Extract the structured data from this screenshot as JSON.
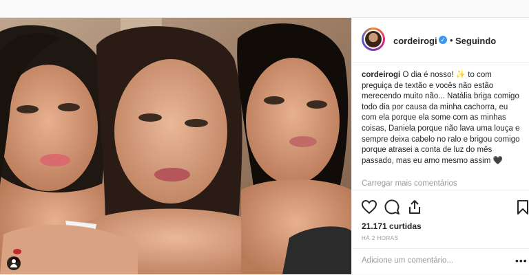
{
  "post": {
    "username": "cordeirogi",
    "verified_icon": "verified-badge-icon",
    "separator": "•",
    "follow_status": "Seguindo",
    "caption_username": "cordeirogi",
    "caption_text": "O dia é nosso! ✨ to com preguiça de textão e vocês não estão merecendo muito não... Natália briga comigo todo dia por causa da minha cachorra, eu com ela porque ela some com as minhas coisas, Daniela porque não lava uma louça e sempre deixa cabelo no ralo e brigou comigo porque atrasei a conta de luz do mês passado, mas eu amo mesmo assim 🖤",
    "load_more": "Carregar mais comentários",
    "likes": "21.171 curtidas",
    "timestamp": "HÁ 2 HORAS",
    "comment_placeholder": "Adicione um comentário...",
    "options": "•••",
    "accent": "#3897f0"
  }
}
